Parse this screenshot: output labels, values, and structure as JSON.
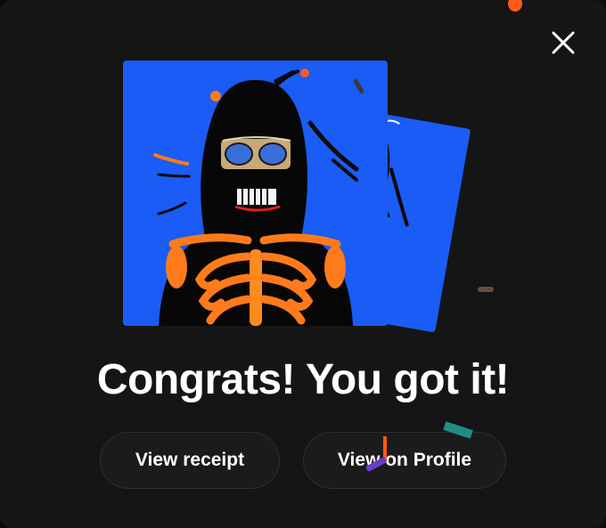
{
  "modal": {
    "headline": "Congrats! You got it!",
    "close_icon": "close-icon"
  },
  "actions": {
    "view_receipt_label": "View receipt",
    "view_profile_label": "View on Profile"
  },
  "artwork": {
    "background_color": "#1a5cf5",
    "accent_color": "#ff7a1a"
  }
}
